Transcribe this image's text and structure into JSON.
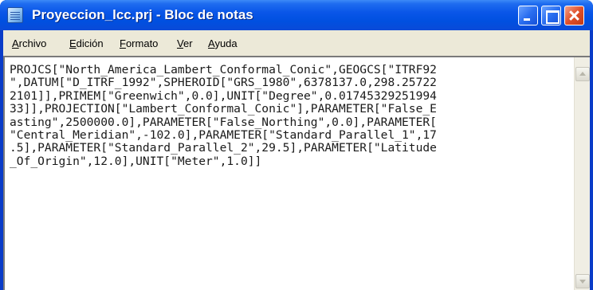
{
  "window": {
    "title": "Proyeccion_lcc.prj - Bloc de notas",
    "icon": "notepad-icon"
  },
  "menubar": {
    "items": [
      {
        "accel": "A",
        "rest": "rchivo"
      },
      {
        "accel": "E",
        "rest": "dición"
      },
      {
        "accel": "F",
        "rest": "ormato"
      },
      {
        "accel": "V",
        "rest": "er"
      },
      {
        "accel": "A",
        "rest": "yuda"
      }
    ]
  },
  "editor": {
    "lines": [
      "PROJCS[\"North_America_Lambert_Conformal_Conic\",GEOGCS[\"ITRF92",
      "\",DATUM[\"D_ITRF_1992\",SPHEROID[\"GRS_1980\",6378137.0,298.25722",
      "2101]],PRIMEM[\"Greenwich\",0.0],UNIT[\"Degree\",0.01745329251994",
      "33]],PROJECTION[\"Lambert_Conformal_Conic\"],PARAMETER[\"False_E",
      "asting\",2500000.0],PARAMETER[\"False_Northing\",0.0],PARAMETER[",
      "\"Central_Meridian\",-102.0],PARAMETER[\"Standard_Parallel_1\",17",
      ".5],PARAMETER[\"Standard_Parallel_2\",29.5],PARAMETER[\"Latitude",
      "_Of_Origin\",12.0],UNIT[\"Meter\",1.0]]"
    ]
  },
  "colors": {
    "titlebar": "#0054e3",
    "menubar": "#ece9d8",
    "close_button": "#e0502a"
  }
}
